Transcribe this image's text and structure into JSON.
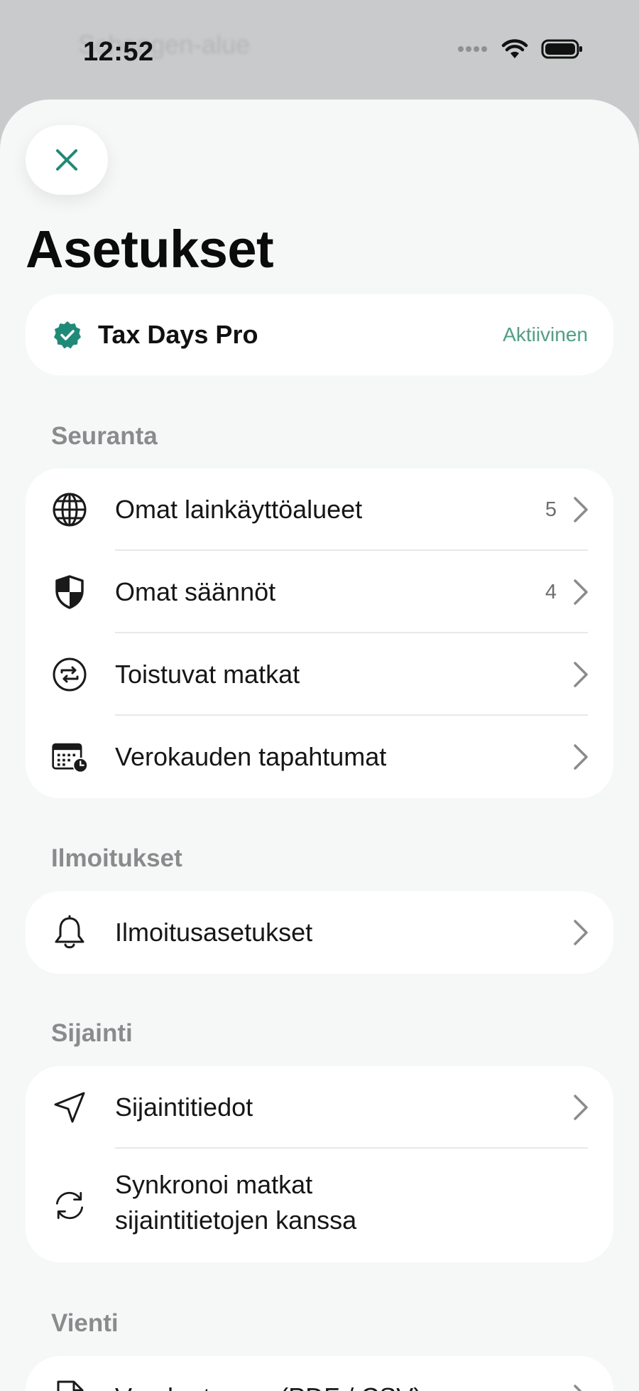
{
  "status_bar": {
    "time": "12:52",
    "background_text": "Schengen-alue"
  },
  "header": {
    "close_icon": "close-icon",
    "title": "Asetukset"
  },
  "subscription": {
    "icon": "verified-badge-icon",
    "name": "Tax Days Pro",
    "status": "Aktiivinen"
  },
  "sections": {
    "tracking": {
      "label": "Seuranta",
      "items": [
        {
          "icon": "globe-icon",
          "label": "Omat lainkäyttöalueet",
          "count": "5"
        },
        {
          "icon": "shield-icon",
          "label": "Omat säännöt",
          "count": "4"
        },
        {
          "icon": "repeat-icon",
          "label": "Toistuvat matkat"
        },
        {
          "icon": "calendar-clock-icon",
          "label": "Verokauden tapahtumat"
        }
      ]
    },
    "notifications": {
      "label": "Ilmoitukset",
      "items": [
        {
          "icon": "bell-icon",
          "label": "Ilmoitusasetukset"
        }
      ]
    },
    "location": {
      "label": "Sijainti",
      "items": [
        {
          "icon": "location-arrow-icon",
          "label": "Sijaintitiedot"
        },
        {
          "icon": "sync-icon",
          "label_line1": "Synkronoi matkat",
          "label_line2": "sijaintitietojen kanssa"
        }
      ]
    },
    "export": {
      "label": "Vienti",
      "items": [
        {
          "icon": "document-icon",
          "label": "Verokertomus (PDF / CSV)"
        }
      ]
    }
  },
  "colors": {
    "accent": "#1f8a78",
    "status_green": "#4aa383",
    "background": "#f6f7f7"
  }
}
